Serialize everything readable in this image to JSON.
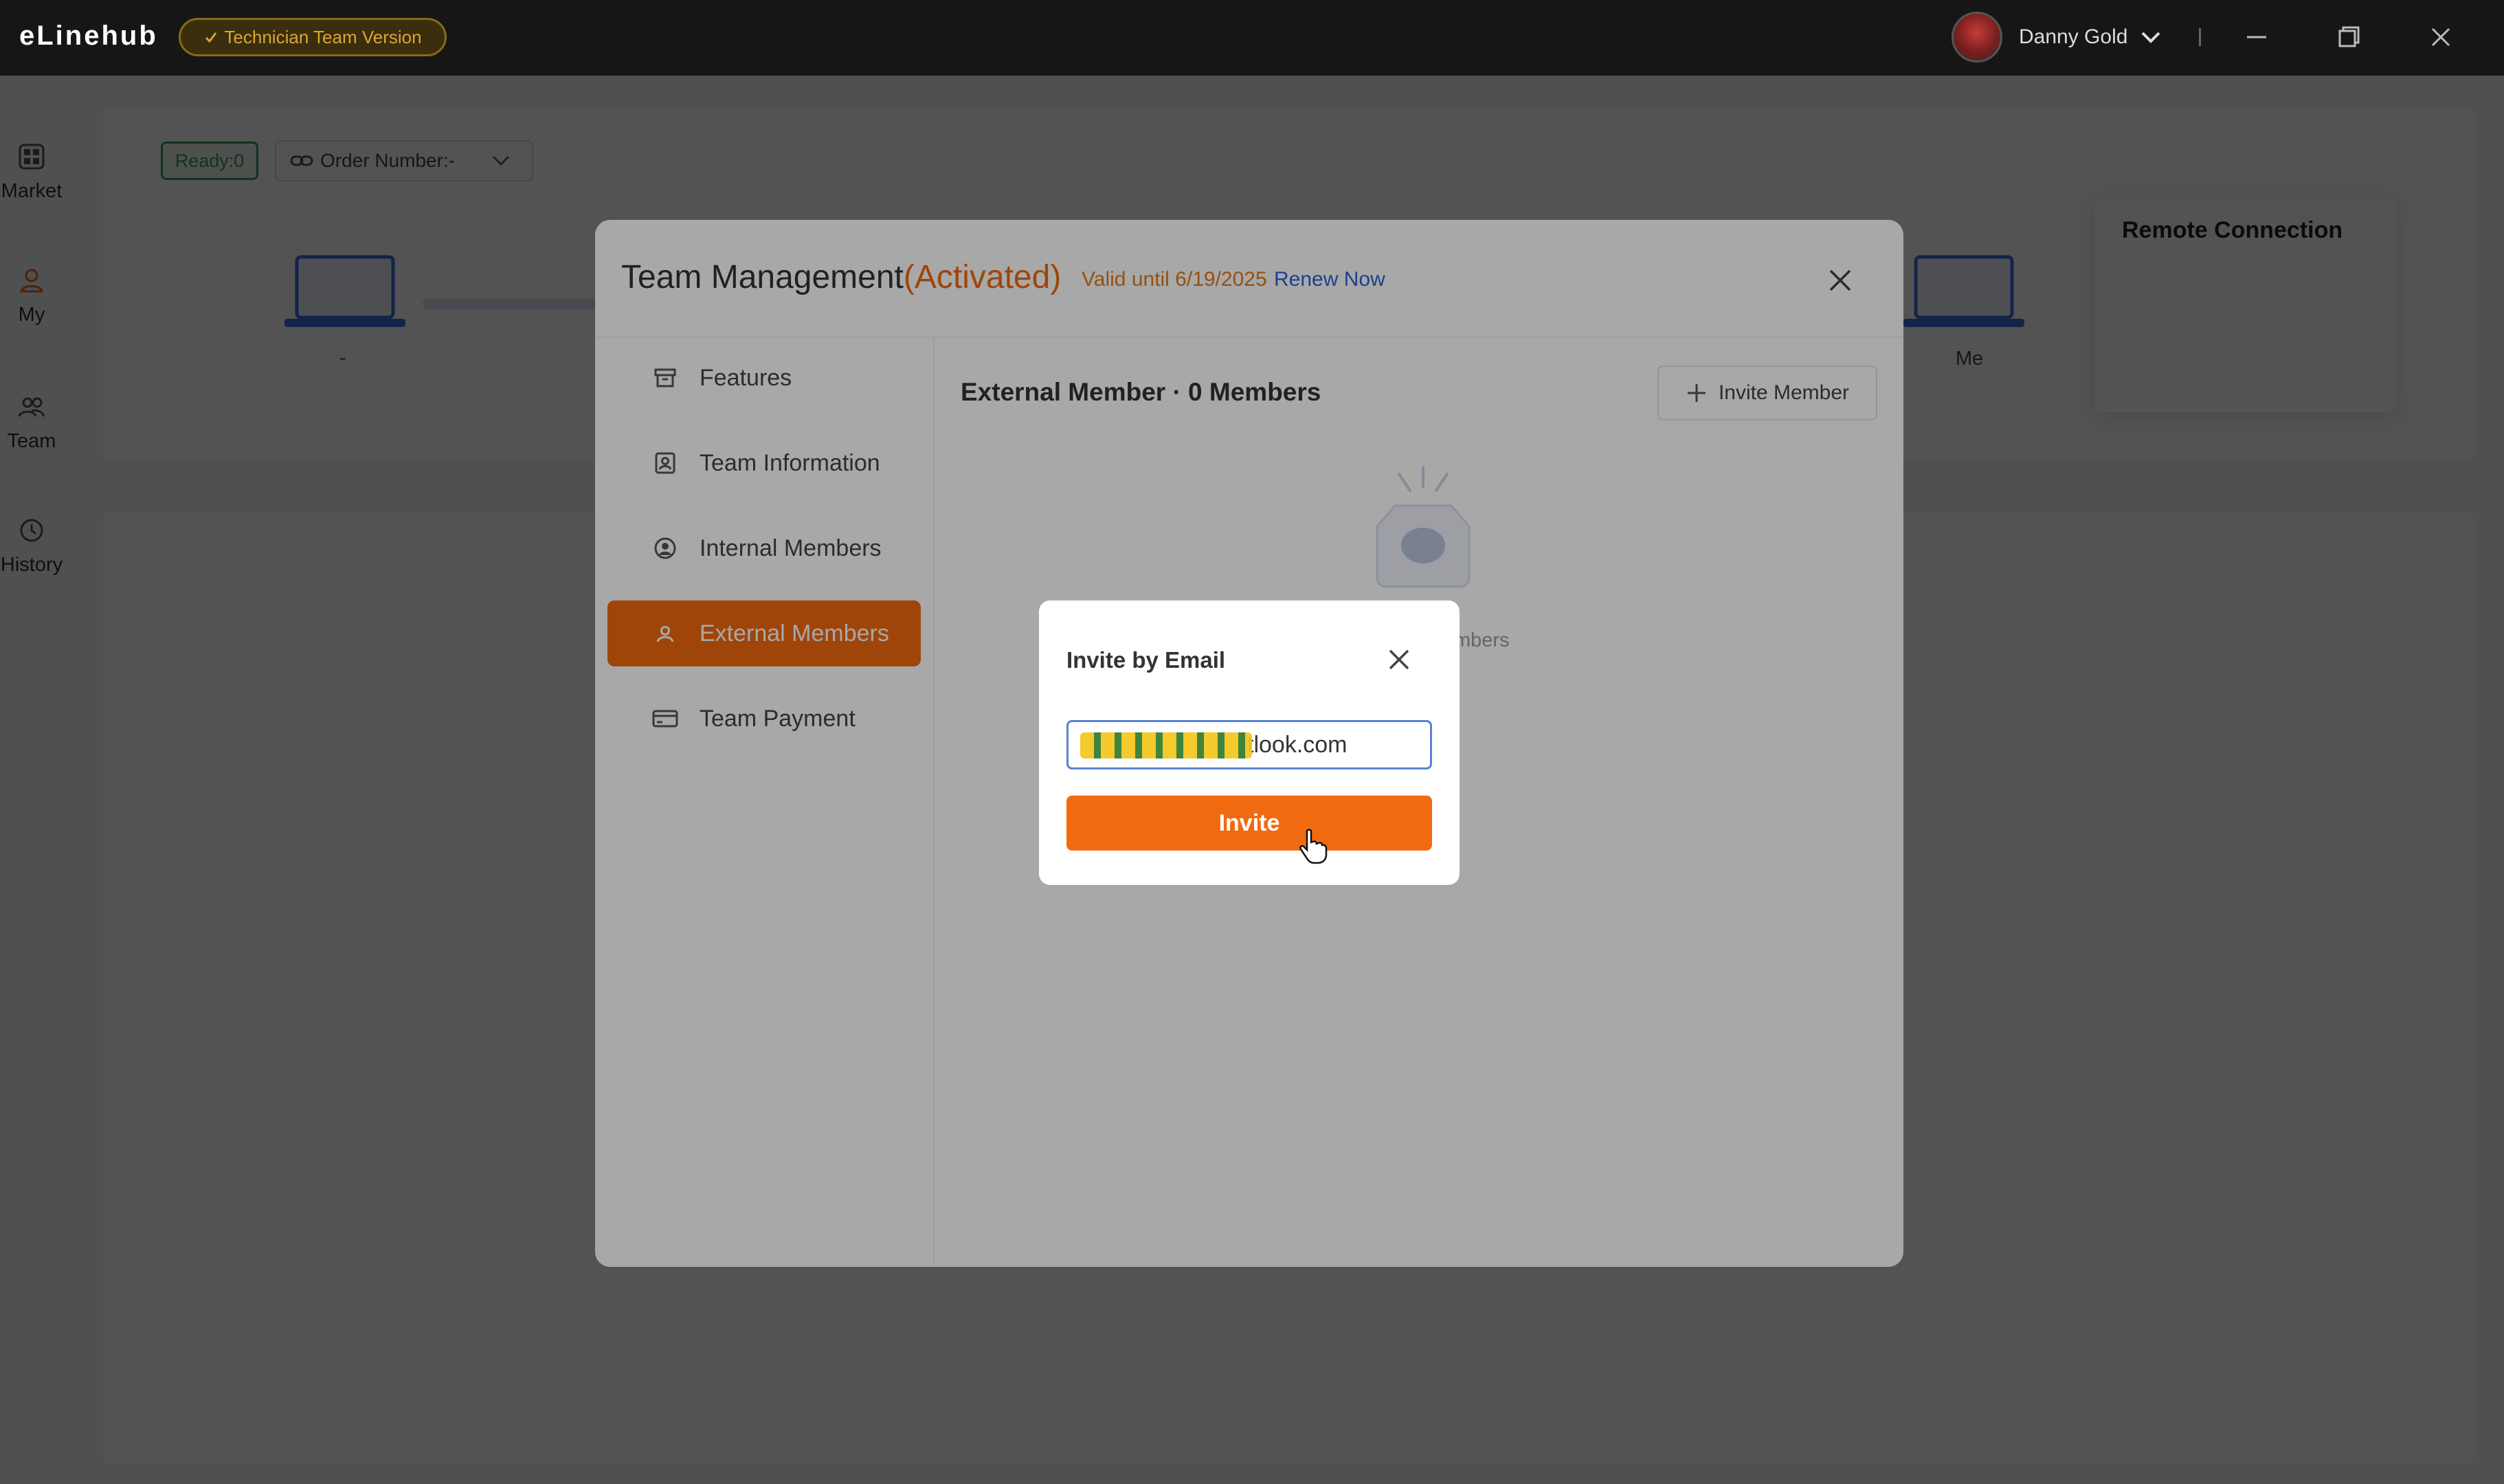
{
  "app": {
    "logo": "eLinehub",
    "version_badge": "Technician Team Version",
    "user_name": "Danny Gold"
  },
  "rail": {
    "items": [
      {
        "label": "Market",
        "icon": "grid-icon"
      },
      {
        "label": "My",
        "icon": "person-icon"
      },
      {
        "label": "Team",
        "icon": "team-icon"
      },
      {
        "label": "History",
        "icon": "clock-icon"
      }
    ]
  },
  "background": {
    "ready_chip": "Ready:0",
    "order_select": "Order Number:-",
    "left_device_label": "-",
    "right_device_label": "Me",
    "remote_connection_title": "Remote Connection"
  },
  "modal": {
    "title": "Team Management",
    "status": "(Activated)",
    "valid_until": "Valid until 6/19/2025",
    "renew_link": "Renew Now",
    "nav": [
      {
        "label": "Features",
        "icon": "archive-icon",
        "active": false
      },
      {
        "label": "Team Information",
        "icon": "id-badge-icon",
        "active": false
      },
      {
        "label": "Internal Members",
        "icon": "user-circle-icon",
        "active": false
      },
      {
        "label": "External Members",
        "icon": "external-user-icon",
        "active": true
      },
      {
        "label": "Team Payment",
        "icon": "credit-card-icon",
        "active": false
      }
    ],
    "content_title": "External Member · 0 Members",
    "invite_member_button": "Invite Member",
    "empty_text_partial": "mbers"
  },
  "invite_dialog": {
    "title": "Invite by Email",
    "email_value": "tlook.com",
    "invite_button": "Invite"
  },
  "colors": {
    "accent": "#f26a0f",
    "link": "#2e62d6",
    "ready_green": "#3d9a55",
    "titlebar": "#161616"
  }
}
